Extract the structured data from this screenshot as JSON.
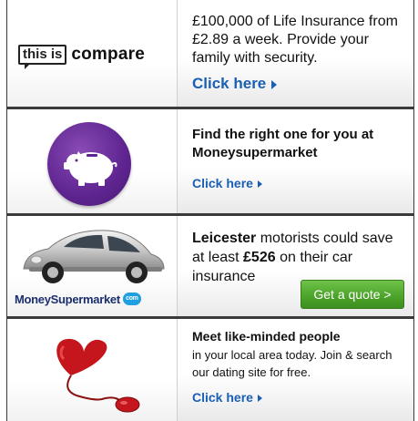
{
  "ads": [
    {
      "logo": {
        "box_text": "this is",
        "word_text": "compare"
      },
      "body": "£100,000 of Life Insurance from £2.89 a week.  Provide your family with security.",
      "cta": "Click here"
    },
    {
      "headline": "Find the right one for you at Moneysupermarket",
      "cta": "Click here"
    },
    {
      "headline_bold": "Leicester",
      "headline_part2": " motorists could save at least ",
      "headline_amount": "£526",
      "headline_part3": " on their car insurance",
      "button": "Get a quote >",
      "logo": {
        "text": "MoneySupermarket",
        "badge": "com"
      }
    },
    {
      "headline": "Meet like-minded people",
      "body": "in your local area today. Join & search our dating site for free.",
      "cta": "Click here"
    }
  ],
  "colors": {
    "link_blue": "#1a5fb4",
    "button_green": "#4ea52c",
    "pig_purple": "#5e2490",
    "border_dark": "#3a3a3a",
    "heart_red": "#c4161c"
  }
}
